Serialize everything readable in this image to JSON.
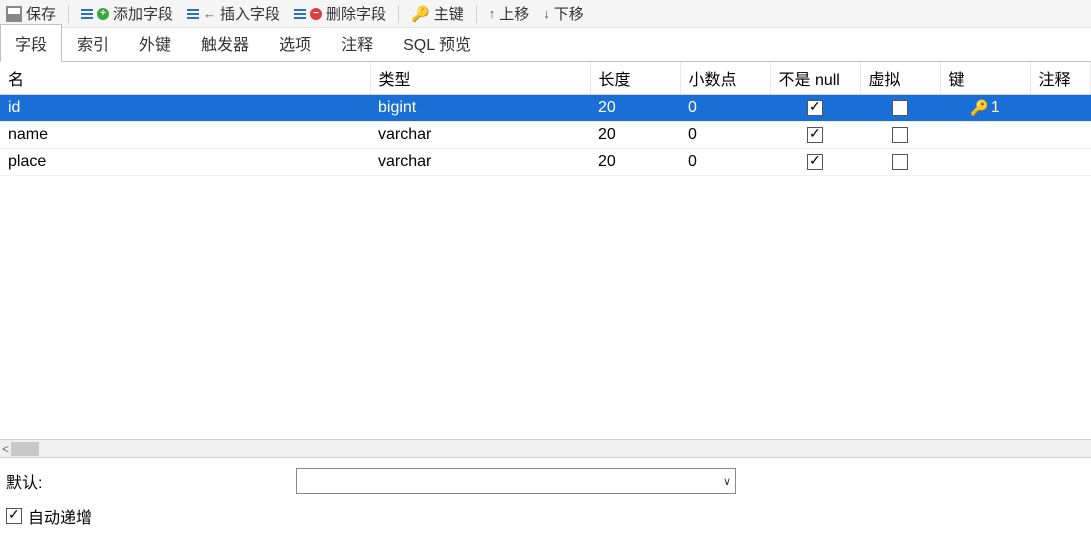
{
  "toolbar": {
    "save": "保存",
    "add_field": "添加字段",
    "insert_field": "插入字段",
    "delete_field": "删除字段",
    "primary_key": "主键",
    "move_up": "上移",
    "move_down": "下移"
  },
  "tabs": {
    "fields": "字段",
    "indexes": "索引",
    "foreign_keys": "外键",
    "triggers": "触发器",
    "options": "选项",
    "comments": "注释",
    "sql_preview": "SQL 预览",
    "active": "fields"
  },
  "columns": {
    "name": "名",
    "type": "类型",
    "length": "长度",
    "decimals": "小数点",
    "not_null": "不是 null",
    "virtual": "虚拟",
    "key": "键",
    "comment": "注释"
  },
  "rows": [
    {
      "name": "id",
      "type": "bigint",
      "length": "20",
      "decimals": "0",
      "not_null": true,
      "virtual": false,
      "key": "1",
      "selected": true
    },
    {
      "name": "name",
      "type": "varchar",
      "length": "20",
      "decimals": "0",
      "not_null": true,
      "virtual": false,
      "key": "",
      "selected": false
    },
    {
      "name": "place",
      "type": "varchar",
      "length": "20",
      "decimals": "0",
      "not_null": true,
      "virtual": false,
      "key": "",
      "selected": false
    }
  ],
  "props": {
    "default_label": "默认:",
    "default_value": "",
    "auto_increment_label": "自动递增",
    "auto_increment": true
  }
}
